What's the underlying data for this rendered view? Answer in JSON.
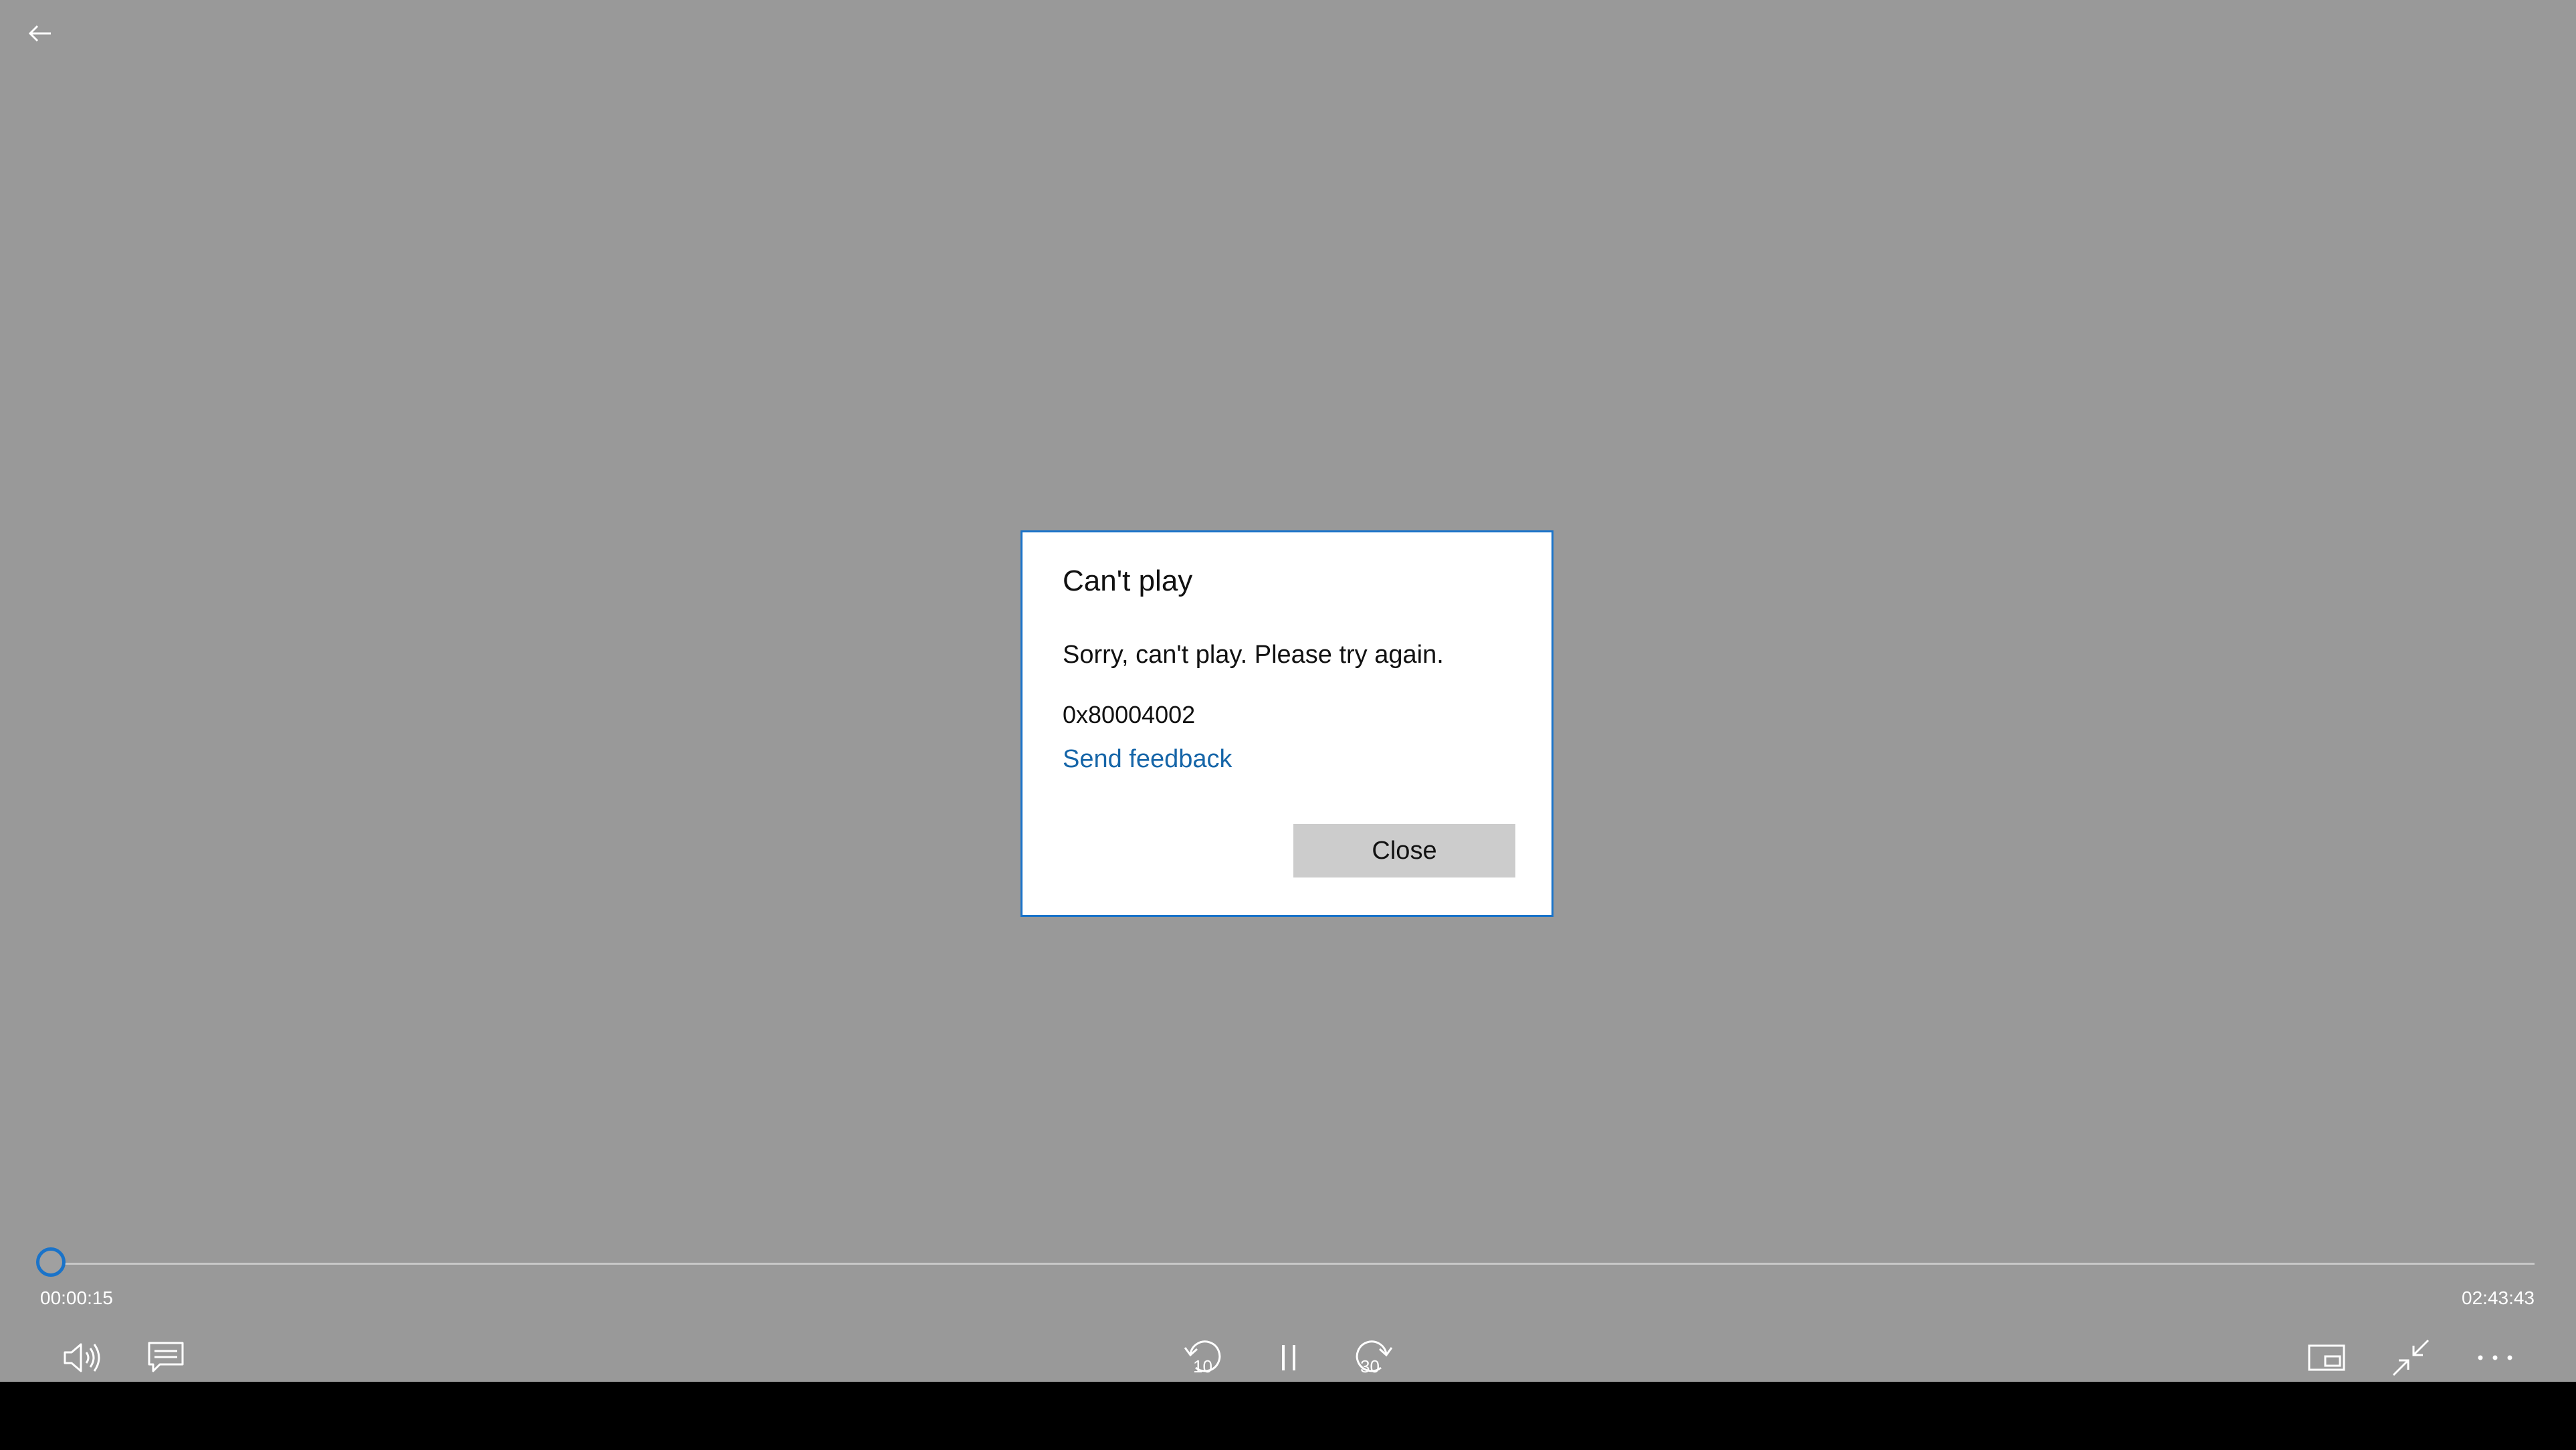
{
  "dialog": {
    "title": "Can't play",
    "message": "Sorry, can't play. Please try again.",
    "error_code": "0x80004002",
    "feedback_link": "Send feedback",
    "close_button": "Close"
  },
  "player": {
    "elapsed": "00:00:15",
    "total": "02:43:43",
    "progress_fraction": 0.0015,
    "skip_back_label": "10",
    "skip_forward_label": "30"
  },
  "icons": {
    "back": "back-arrow-icon",
    "volume": "volume-icon",
    "captions": "captions-icon",
    "skip_back": "skip-back-10-icon",
    "pause": "pause-icon",
    "skip_forward": "skip-forward-30-icon",
    "mini_view": "mini-view-icon",
    "exit_fullscreen": "exit-fullscreen-icon",
    "more": "more-icon"
  },
  "colors": {
    "accent": "#1a73c9",
    "link": "#1565a8",
    "stage": "#999999",
    "taskbar": "#000000"
  }
}
